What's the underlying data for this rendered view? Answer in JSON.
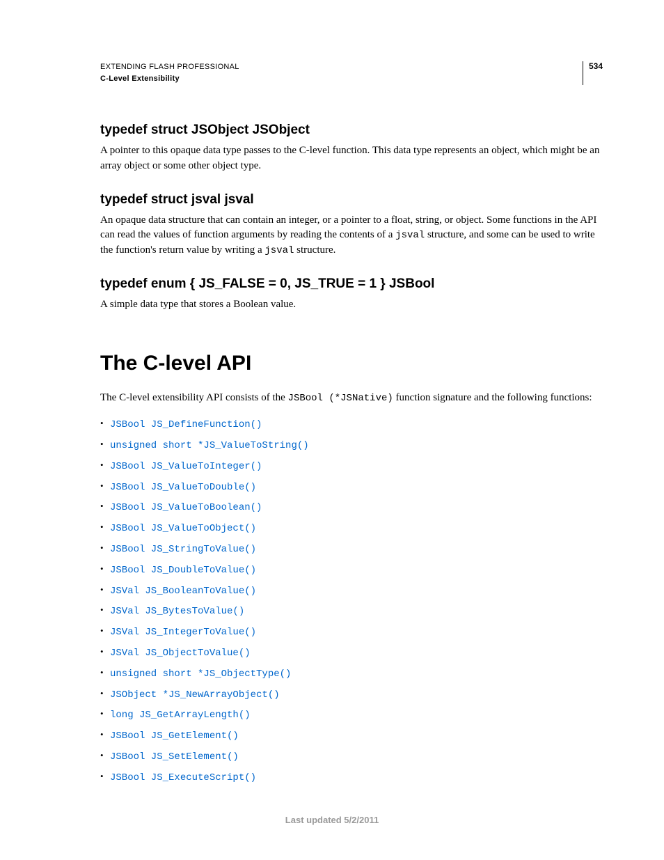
{
  "header": {
    "title": "EXTENDING FLASH PROFESSIONAL",
    "subtitle": "C-Level Extensibility",
    "page_number": "534"
  },
  "sections": {
    "jsobject": {
      "heading": "typedef struct JSObject JSObject",
      "body": "A pointer to this opaque data type passes to the C-level function. This data type represents an object, which might be an array object or some other object type."
    },
    "jsval": {
      "heading": "typedef struct jsval jsval",
      "body_pre1": "An opaque data structure that can contain an integer, or a pointer to a float, string, or object. Some functions in the API can read the values of function arguments by reading the contents of a ",
      "code1": "jsval",
      "body_mid": " structure, and some can be used to write the function's return value by writing a ",
      "code2": "jsval",
      "body_post": " structure."
    },
    "jsbool": {
      "heading": "typedef enum { JS_FALSE = 0, JS_TRUE = 1 } JSBool",
      "body": "A simple data type that stores a Boolean value."
    }
  },
  "main_heading": "The C-level API",
  "intro": {
    "pre": "The C-level extensibility API consists of the ",
    "code": "JSBool (*JSNative)",
    "post": " function signature and the following functions:"
  },
  "functions": [
    "JSBool JS_DefineFunction()",
    "unsigned short *JS_ValueToString()",
    "JSBool JS_ValueToInteger()",
    "JSBool JS_ValueToDouble()",
    "JSBool JS_ValueToBoolean()",
    "JSBool JS_ValueToObject()",
    "JSBool JS_StringToValue()",
    "JSBool JS_DoubleToValue()",
    "JSVal JS_BooleanToValue()",
    "JSVal JS_BytesToValue()",
    "JSVal JS_IntegerToValue()",
    "JSVal JS_ObjectToValue()",
    "unsigned short *JS_ObjectType()",
    "JSObject *JS_NewArrayObject()",
    "long JS_GetArrayLength()",
    "JSBool JS_GetElement()",
    "JSBool JS_SetElement()",
    "JSBool JS_ExecuteScript()"
  ],
  "footer": "Last updated 5/2/2011"
}
